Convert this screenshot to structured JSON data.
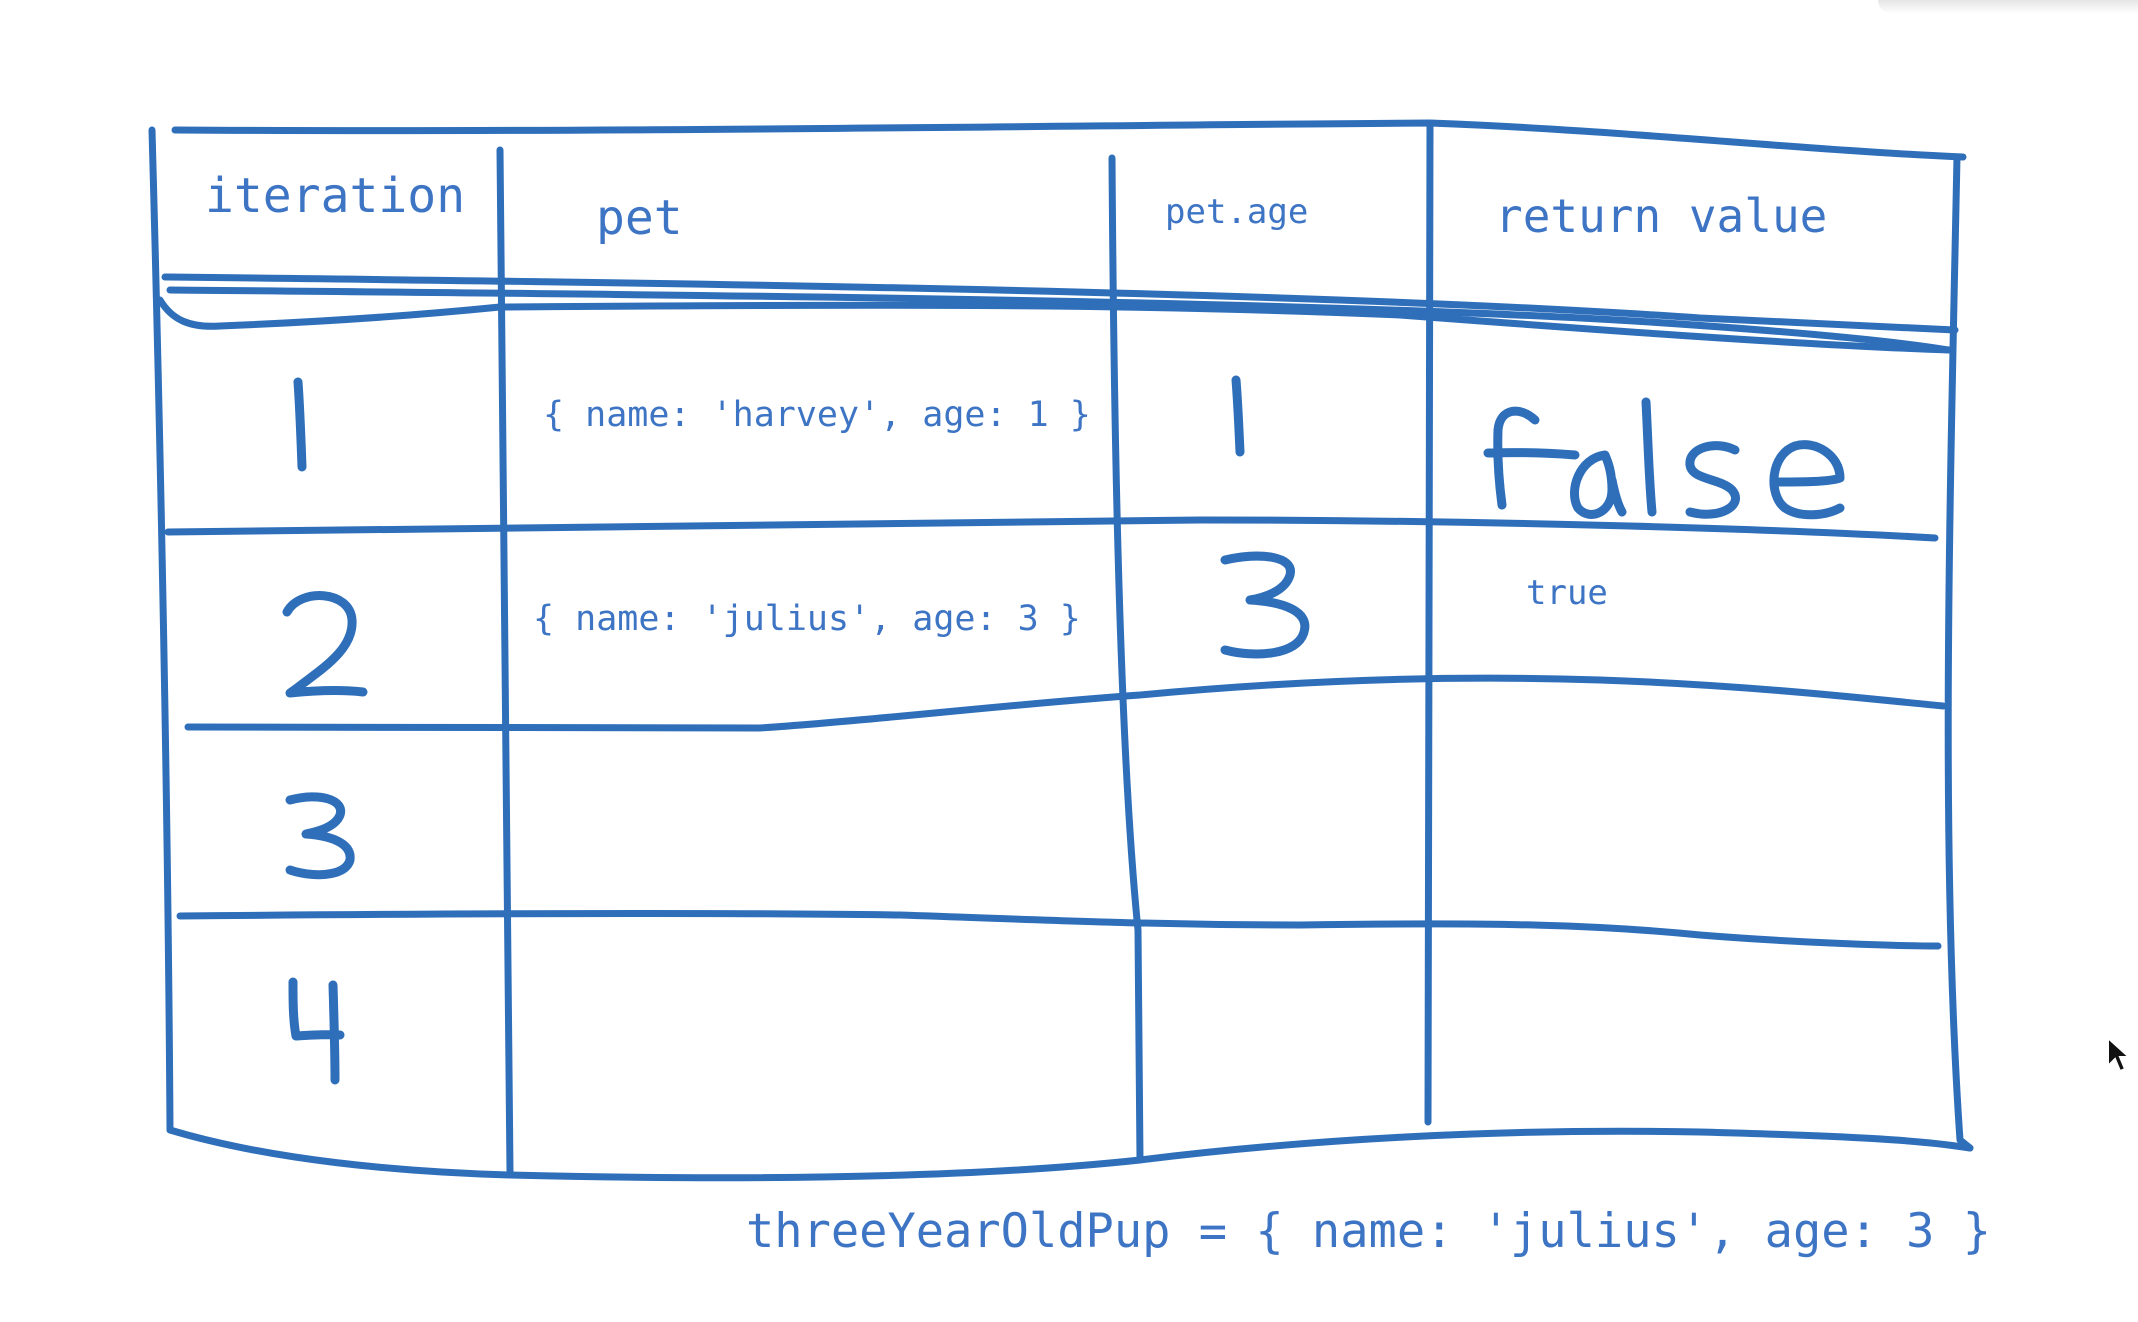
{
  "table": {
    "headers": {
      "iteration": "iteration",
      "pet": "pet",
      "pet_age": "pet.age",
      "return_value": "return value"
    },
    "rows": [
      {
        "iteration": "1",
        "pet": "{ name: 'harvey', age: 1 }",
        "pet_age": "1",
        "return_value": "false"
      },
      {
        "iteration": "2",
        "pet": "{ name: 'julius', age: 3 }",
        "pet_age": "3",
        "return_value": "true"
      },
      {
        "iteration": "3",
        "pet": "",
        "pet_age": "",
        "return_value": ""
      },
      {
        "iteration": "4",
        "pet": "",
        "pet_age": "",
        "return_value": ""
      }
    ]
  },
  "result": "threeYearOldPup = { name: 'julius', age: 3 }",
  "colors": {
    "ink": "#2f6fba",
    "text": "#3d74c4"
  }
}
